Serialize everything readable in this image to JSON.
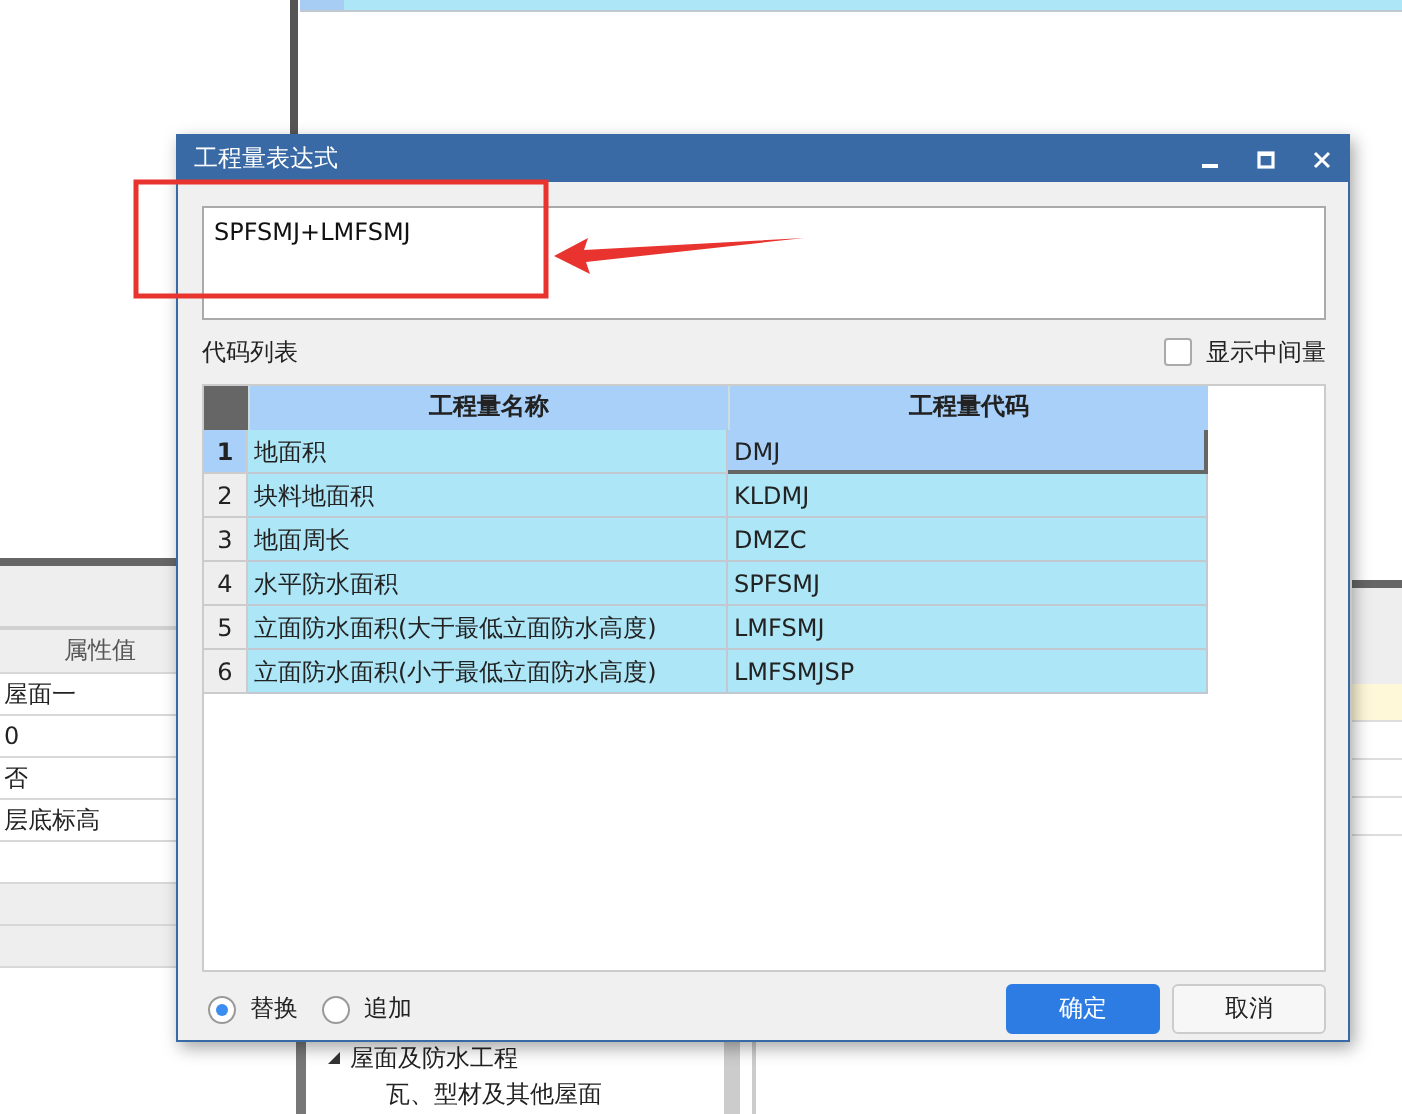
{
  "background": {
    "property_table": {
      "header": "属性值",
      "rows": [
        "屋面一",
        "0",
        "否",
        "层底标高"
      ]
    },
    "tree": [
      {
        "label": "屋面及防水工程",
        "expanded": true,
        "children": [
          {
            "label": "瓦、型材及其他屋面"
          }
        ]
      }
    ]
  },
  "dialog": {
    "title": "工程量表达式",
    "expression": "SPFSMJ+LMFSMJ",
    "code_list_label": "代码列表",
    "show_intermediate": {
      "label": "显示中间量",
      "checked": false
    },
    "table": {
      "columns": [
        "工程量名称",
        "工程量代码"
      ],
      "rows": [
        {
          "number": "1",
          "name": "地面积",
          "code": "DMJ",
          "selected": true
        },
        {
          "number": "2",
          "name": "块料地面积",
          "code": "KLDMJ",
          "selected": false
        },
        {
          "number": "3",
          "name": "地面周长",
          "code": "DMZC",
          "selected": false
        },
        {
          "number": "4",
          "name": "水平防水面积",
          "code": "SPFSMJ",
          "selected": false
        },
        {
          "number": "5",
          "name": "立面防水面积(大于最低立面防水高度)",
          "code": "LMFSMJ",
          "selected": false
        },
        {
          "number": "6",
          "name": "立面防水面积(小于最低立面防水高度)",
          "code": "LMFSMJSP",
          "selected": false
        }
      ]
    },
    "modes": [
      {
        "label": "替换",
        "selected": true
      },
      {
        "label": "追加",
        "selected": false
      }
    ],
    "buttons": [
      {
        "label": "确定",
        "kind": "primary"
      },
      {
        "label": "取消",
        "kind": "secondary"
      }
    ]
  }
}
